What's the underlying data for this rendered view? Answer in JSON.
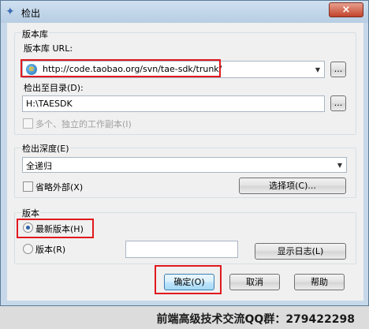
{
  "window": {
    "title": "检出",
    "close_label": "×"
  },
  "repo": {
    "group_label": "版本库",
    "url_label": "版本库 URL:",
    "url_value": "http://code.taobao.org/svn/tae-sdk/trunk/",
    "checkout_dir_label": "检出至目录(D):",
    "checkout_dir_value": "H:\\TAESDK",
    "browse_label": "...",
    "multi_copy_label": "多个、独立的工作副本(I)"
  },
  "depth": {
    "group_label": "检出深度(E)",
    "selected": "全递归",
    "omit_externals_label": "省略外部(X)",
    "options_button": "选择项(C)..."
  },
  "revision": {
    "group_label": "版本",
    "head_label": "最新版本(H)",
    "revision_label": "版本(R)",
    "revision_value": "",
    "show_log_button": "显示日志(L)"
  },
  "buttons": {
    "ok": "确定(O)",
    "cancel": "取消",
    "help": "帮助"
  },
  "footer": {
    "text": "前端高级技术交流QQ群：279422298"
  },
  "colors": {
    "highlight_border": "#e0191e"
  }
}
